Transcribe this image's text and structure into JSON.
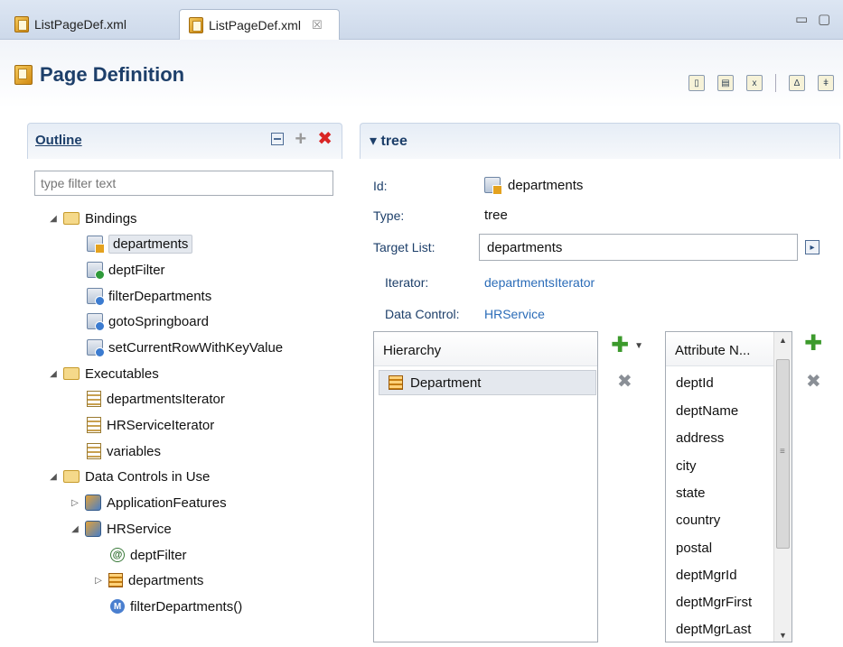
{
  "tabs": [
    {
      "label": "ListPageDef.xml"
    },
    {
      "label": "ListPageDef.xml",
      "close": "☒"
    }
  ],
  "window_controls": {
    "minimize": "▭",
    "maximize": "▢"
  },
  "header": {
    "title": "Page Definition"
  },
  "outline": {
    "title": "Outline",
    "filter_placeholder": "type filter text",
    "tree": {
      "bindings": {
        "label": "Bindings",
        "items": [
          "departments",
          "deptFilter",
          "filterDepartments",
          "gotoSpringboard",
          "setCurrentRowWithKeyValue"
        ]
      },
      "executables": {
        "label": "Executables",
        "items": [
          "departmentsIterator",
          "HRServiceIterator",
          "variables"
        ]
      },
      "data_controls": {
        "label": "Data Controls in Use",
        "app_features": "ApplicationFeatures",
        "hrservice": "HRService",
        "hr_children": [
          "deptFilter",
          "departments",
          "filterDepartments()"
        ]
      }
    }
  },
  "detail": {
    "section_title": "tree",
    "id_label": "Id:",
    "id_value": "departments",
    "type_label": "Type:",
    "type_value": "tree",
    "target_label": "Target List:",
    "target_value": "departments",
    "iterator_label": "Iterator:",
    "iterator_value": "departmentsIterator",
    "datacontrol_label": "Data Control:",
    "datacontrol_value": "HRService",
    "hierarchy": {
      "header": "Hierarchy",
      "rows": [
        "Department"
      ]
    },
    "attributes": {
      "header": "Attribute N...",
      "items": [
        "deptId",
        "deptName",
        "address",
        "city",
        "state",
        "country",
        "postal",
        "deptMgrId",
        "deptMgrFirst",
        "deptMgrLast"
      ]
    }
  }
}
